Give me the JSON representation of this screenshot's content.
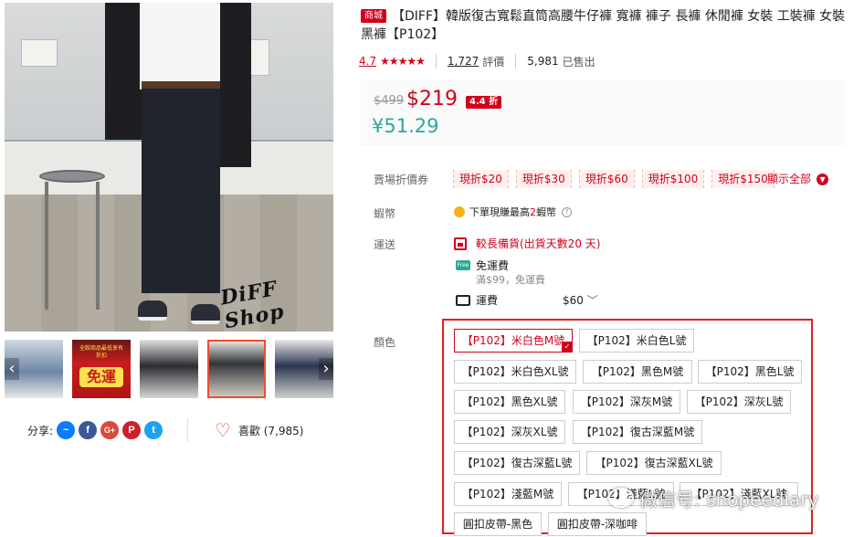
{
  "product": {
    "mall_badge": "商城",
    "title": "【DIFF】韓版復古寬鬆直筒高腰牛仔褲 寬褲 褲子 長褲 休閒褲 女裝 工裝褲 女裝 黑褲【P102】"
  },
  "gallery": {
    "main_image_sign": "DiFF Shop",
    "promo_thumb_text": "全館商品最低享有折扣",
    "promo_thumb_big": "免運"
  },
  "rating": {
    "score": "4.7",
    "stars": "★★★★★",
    "review_count": "1,727",
    "review_label": "評價",
    "sold_count": "5,981",
    "sold_label": "已售出"
  },
  "price": {
    "original": "$499",
    "current": "$219",
    "discount": "4.4 折",
    "rmb": "¥51.29"
  },
  "vouchers": {
    "label": "賣場折價券",
    "items": [
      "現折$20",
      "現折$30",
      "現折$60",
      "現折$100",
      "現折$150"
    ],
    "show_all": "顯示全部"
  },
  "coins": {
    "label": "蝦幣",
    "text_before": "下單現賺最高",
    "amount": "2",
    "text_after": "蝦幣"
  },
  "shipping": {
    "label": "運送",
    "preorder": "較長備貨(出貨天數20 天)",
    "free_badge": "Free",
    "free_title": "免運費",
    "free_condition": "滿$99，免運費",
    "fee_label": "運費",
    "fee_value": "$60"
  },
  "variants": {
    "label": "顏色",
    "items": [
      "【P102】米白色M號",
      "【P102】米白色L號",
      "【P102】米白色XL號",
      "【P102】黑色M號",
      "【P102】黑色L號",
      "【P102】黑色XL號",
      "【P102】深灰M號",
      "【P102】深灰L號",
      "【P102】深灰XL號",
      "【P102】復古深藍M號",
      "【P102】復古深藍L號",
      "【P102】復古深藍XL號",
      "【P102】淺藍M號",
      "【P102】淺藍L號",
      "【P102】淺藍XL號",
      "圓扣皮帶-黑色",
      "圓扣皮帶-深咖啡"
    ],
    "selected_index": 0
  },
  "social": {
    "share_label": "分享:",
    "like_label": "喜歡 (7,985)"
  },
  "watermark": {
    "text": "微信号: shopeediary"
  },
  "colors": {
    "accent": "#d0011b",
    "rmb": "#26aa99",
    "highlight_frame": "#e0201f"
  }
}
